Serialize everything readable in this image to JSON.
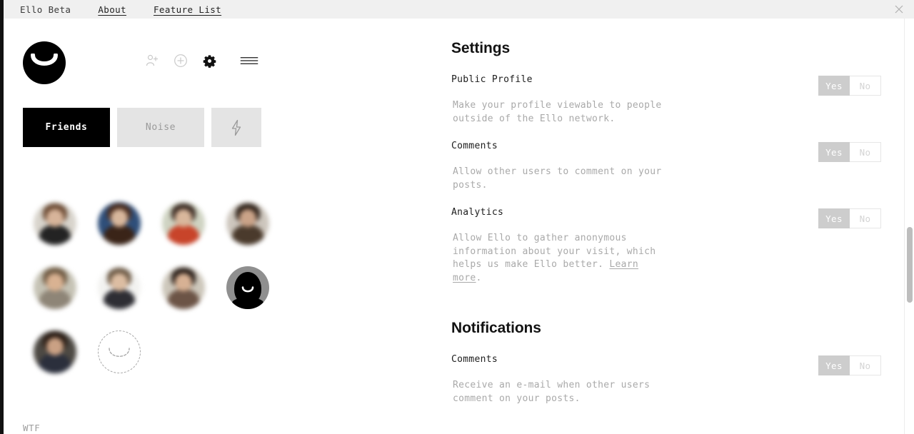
{
  "topbar": {
    "brand": "Ello Beta",
    "links": [
      {
        "label": "About",
        "name": "topbar-link-about"
      },
      {
        "label": "Feature List",
        "name": "topbar-link-feature-list"
      }
    ],
    "close_icon": "close-icon"
  },
  "sidebar": {
    "logo_icon": "ello-logo-icon",
    "icons": [
      {
        "name": "add-person-icon",
        "label": "Invite"
      },
      {
        "name": "plus-circle-icon",
        "label": "New Post"
      },
      {
        "name": "gear-icon",
        "label": "Settings"
      },
      {
        "name": "hamburger-menu-icon",
        "label": "Menu"
      }
    ],
    "tabs": [
      {
        "label": "Friends",
        "state": "active"
      },
      {
        "label": "Noise",
        "state": "inactive"
      },
      {
        "label": "",
        "state": "icon",
        "icon": "lightning-bolt-icon"
      }
    ],
    "avatars": [
      {
        "type": "photo",
        "sky": "#d8d4cc",
        "hair": "#6b4a33",
        "head": "#d7b49a",
        "body": "#232323"
      },
      {
        "type": "photo",
        "sky": "#2f4f7a",
        "hair": "#4a2c1d",
        "head": "#d8b79c",
        "body": "#3a2418"
      },
      {
        "type": "photo",
        "sky": "#cfd3c2",
        "hair": "#3a2a22",
        "head": "#d9b79c",
        "body": "#c8442a"
      },
      {
        "type": "photo",
        "sky": "#cdc6bd",
        "hair": "#2c2018",
        "head": "#caa388",
        "body": "#4a3a2c"
      },
      {
        "type": "photo",
        "sky": "#c6c3b5",
        "hair": "#6f5a43",
        "head": "#d9b292",
        "body": "#8e8577"
      },
      {
        "type": "photo",
        "sky": "#f2f2f0",
        "hair": "#6d5a46",
        "head": "#dcbda2",
        "body": "#2e2e34"
      },
      {
        "type": "photo",
        "sky": "#cdc7bb",
        "hair": "#2a1f19",
        "head": "#d7b194",
        "body": "#6c5446"
      },
      {
        "type": "ello-placeholder"
      },
      {
        "type": "photo",
        "sky": "#4e4a44",
        "hair": "#2a1c14",
        "head": "#caa184",
        "body": "#2b2f3c"
      },
      {
        "type": "outline-placeholder"
      }
    ],
    "footer_label": "WTF"
  },
  "settings": {
    "sections": [
      {
        "heading": "Settings",
        "rows": [
          {
            "label": "Public Profile",
            "description": "Make your profile viewable to people outside of the Ello network.",
            "toggle": {
              "yes": "Yes",
              "no": "No",
              "selected": "Yes"
            }
          },
          {
            "label": "Comments",
            "description": "Allow other users to comment on your posts.",
            "toggle": {
              "yes": "Yes",
              "no": "No",
              "selected": "Yes"
            }
          },
          {
            "label": "Analytics",
            "description_parts": {
              "before": "Allow Ello to gather anonymous information about your visit, which helps us make Ello better. ",
              "link": "Learn more",
              "after": "."
            },
            "toggle": {
              "yes": "Yes",
              "no": "No",
              "selected": "Yes"
            }
          }
        ]
      },
      {
        "heading": "Notifications",
        "rows": [
          {
            "label": "Comments",
            "description": "Receive an e-mail when other users comment on your posts.",
            "toggle": {
              "yes": "Yes",
              "no": "No",
              "selected": "Yes"
            }
          }
        ]
      }
    ]
  },
  "colors": {
    "toggle_active_bg": "#cdcdcd",
    "toggle_active_text": "#ffffff",
    "toggle_inactive_text": "#d4d4d4",
    "tab_active_bg": "#000000",
    "tab_inactive_bg": "#e4e4e4",
    "topbar_bg": "#f0f0f0",
    "muted_text": "#a9a9a9"
  }
}
